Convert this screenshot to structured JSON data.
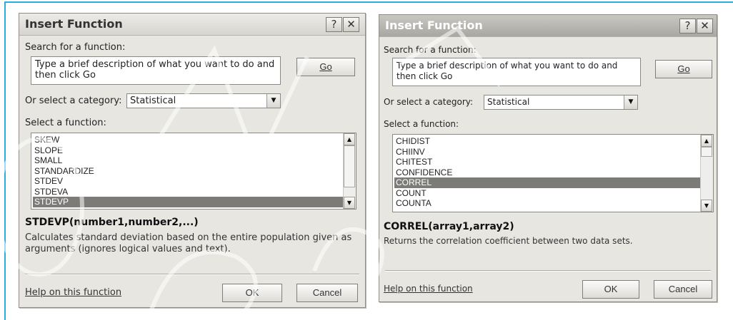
{
  "dialogs": [
    {
      "title": "Insert Function",
      "help_btn": "?",
      "close_btn": "✕",
      "search_label": "Search for a function:",
      "search_text": "Type a brief description of what you want to do and then click Go",
      "go_label": "Go",
      "category_label": "Or select a category:",
      "category_value": "Statistical",
      "select_label": "Select a function:",
      "functions": [
        "SKEW",
        "SLOPE",
        "SMALL",
        "STANDARDIZE",
        "STDEV",
        "STDEVA",
        "STDEVP"
      ],
      "selected_function": "STDEVP",
      "signature": "STDEVP(number1,number2,...)",
      "description": "Calculates standard deviation based on the entire population given as arguments (ignores logical values and text).",
      "help_link": "Help on this function",
      "ok_label": "OK",
      "cancel_label": "Cancel"
    },
    {
      "title": "Insert Function",
      "help_btn": "?",
      "close_btn": "✕",
      "search_label": "Search for a function:",
      "search_text": "Type a brief description of what you want to do and then click Go",
      "go_label": "Go",
      "category_label": "Or select a category:",
      "category_value": "Statistical",
      "select_label": "Select a function:",
      "functions": [
        "CHIDIST",
        "CHIINV",
        "CHITEST",
        "CONFIDENCE",
        "CORREL",
        "COUNT",
        "COUNTA"
      ],
      "selected_function": "CORREL",
      "signature": "CORREL(array1,array2)",
      "description": "Returns the correlation coefficient between two data sets.",
      "help_link": "Help on this function",
      "ok_label": "OK",
      "cancel_label": "Cancel"
    }
  ],
  "icons": {
    "dropdown": "chevron-down-icon",
    "scroll_up": "arrow-up-icon",
    "scroll_down": "arrow-down-icon"
  },
  "colors": {
    "frame_accent": "#29aee0",
    "dialog_bg": "#e7e6e1",
    "selection": "#7c7b78"
  }
}
